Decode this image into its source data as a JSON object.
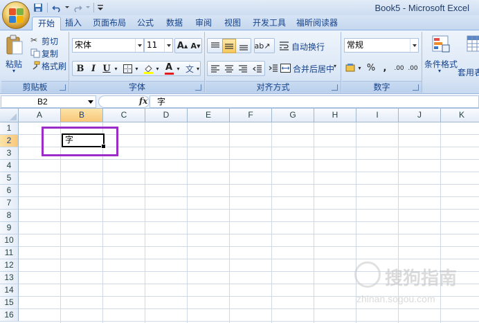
{
  "window": {
    "title": "Book5 - Microsoft Excel"
  },
  "qat": {
    "icons": [
      "save-icon",
      "undo-icon",
      "redo-icon",
      "customize-icon"
    ]
  },
  "tabs": [
    "开始",
    "插入",
    "页面布局",
    "公式",
    "数据",
    "审阅",
    "视图",
    "开发工具",
    "福昕阅读器"
  ],
  "active_tab": "开始",
  "ribbon": {
    "clipboard": {
      "label": "剪贴板",
      "paste": "粘贴",
      "cut": "剪切",
      "copy": "复制",
      "format_painter": "格式刷"
    },
    "font": {
      "label": "字体",
      "font_name": "宋体",
      "font_size": "11",
      "bold": "B",
      "italic": "I",
      "underline": "U",
      "font_color_glyph": "A",
      "phonetic_glyph": "文"
    },
    "alignment": {
      "label": "对齐方式",
      "wrap_text": "自动换行",
      "merge_center": "合并后居中"
    },
    "number": {
      "label": "数字",
      "format": "常规",
      "percent": "%",
      "comma": ",",
      "inc_decimal": ".00",
      "dec_decimal": ".00"
    },
    "styles": {
      "conditional_format": "条件格式",
      "table_format": "套用表格格"
    }
  },
  "formula_bar": {
    "name_box": "B2",
    "fx": "fx",
    "content": "字"
  },
  "columns": [
    "A",
    "B",
    "C",
    "D",
    "E",
    "F",
    "G",
    "H",
    "I",
    "J",
    "K"
  ],
  "rows": [
    "1",
    "2",
    "3",
    "4",
    "5",
    "6",
    "7",
    "8",
    "9",
    "10",
    "11",
    "12",
    "13",
    "14",
    "15",
    "16"
  ],
  "selected": {
    "column": "B",
    "row": "2",
    "cell_value": "字"
  },
  "highlight_color": "#9b2cc7",
  "watermark": {
    "line1": "搜狗指南",
    "line2": "zhinan.sogou.com"
  }
}
